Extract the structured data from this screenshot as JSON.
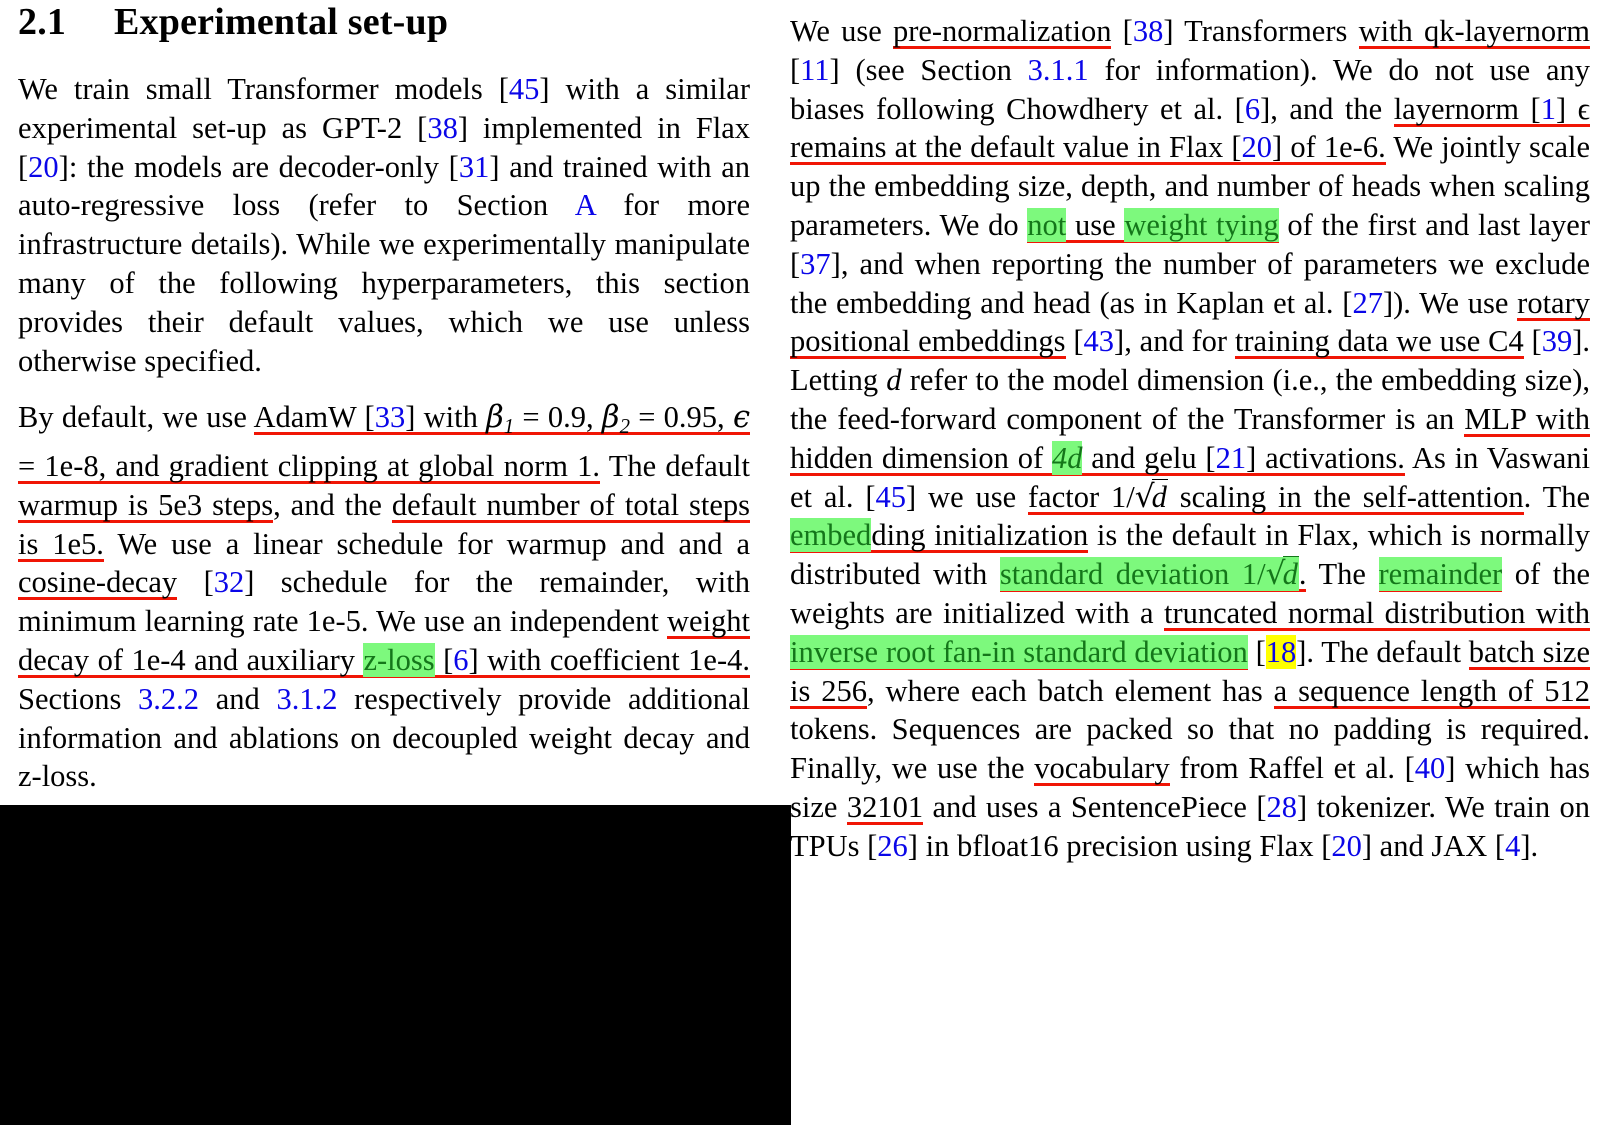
{
  "document": {
    "type": "academic-paper-excerpt",
    "heading": {
      "number": "2.1",
      "title": "Experimental set-up"
    },
    "colors": {
      "citation_blue": "#0a06e8",
      "annotation_underline_red": "#f01505",
      "highlight_green": "#7df97d",
      "highlight_green_text": "#14761a",
      "highlight_yellow": "#ffff00",
      "redaction_black": "#000000",
      "body_text": "#000000",
      "page_background": "#ffffff"
    }
  },
  "left_column": {
    "paragraph_1": {
      "t1": "We train small Transformer models ",
      "c45": "45",
      "t2": " with a similar experimental set-up as GPT-2 ",
      "c38": "38",
      "t3": " implemented in Flax ",
      "c20": "20",
      "t4": ": the models are decoder-only ",
      "c31": "31",
      "t5": " and trained with an auto-regressive loss (refer to Section ",
      "refA": "A",
      "t6": " for more infrastructure details). While we experimentally manipulate many of the following hyperparameters, this section provides their default values, which we use unless otherwise specified."
    },
    "paragraph_2": {
      "t1": "By default, we use ",
      "u1_a": "AdamW ",
      "c33": "33",
      "u1_b": " with ",
      "beta": "β",
      "sub1": "1",
      "eq1": " = 0.9, ",
      "sub2": "2",
      "eq2": " = 0.95, ",
      "epsilon": "ϵ",
      "eq3": " = 1e-8, and gradient clipping at global norm 1.",
      "t2": " The default ",
      "u2": "warmup is 5e3 steps",
      "t3": ", and the ",
      "u3": "default number of total steps is 1e5.",
      "t4": " We use a linear schedule for warmup and and a ",
      "u4": "cosine-decay",
      "t5": " ",
      "c32": "32",
      "t6": " schedule for the remainder, with minimum learning rate 1e-5. We use an independent ",
      "u5_a": "weight decay of 1e-4 and auxiliary ",
      "hl_zloss": "z-loss",
      "u5_b": " ",
      "c6": "6",
      "u5_c": " with coefficient 1e-4.",
      "t7": " Sections ",
      "ref322": "3.2.2",
      "t8": " and ",
      "ref312": "3.1.2",
      "t9": " respectively provide additional information and ablations on decoupled weight decay and z-loss."
    }
  },
  "right_column": {
    "paragraph_1": {
      "t1": "We use ",
      "u1": "pre-normalization",
      "t2": " ",
      "c38": "38",
      "t3": " Transformers ",
      "u2_a": "with qk-layernorm",
      "t4": " ",
      "c11": "11",
      "t5": " (see Section ",
      "ref311": "3.1.1",
      "t6": " for information). We do not use any biases following Chowdhery et al. ",
      "c6": "6",
      "t7": ", and the ",
      "u3_a": "layernorm ",
      "c1": "1",
      "u3_b": " ϵ remains at the default value in Flax ",
      "c20": "20",
      "u3_c": " of 1e-6.",
      "t8": " We jointly scale up the embedding size, depth, and number of heads when scaling parameters. We do ",
      "hl_not": "not",
      "t9": " use ",
      "hl_weight_tying": "weight tying",
      "t10": " of the first and last layer ",
      "c37": "37",
      "t11": ", and when reporting the number of parameters we exclude the embedding and head (as in Kaplan et al. ",
      "c27": "27",
      "t12": "). We use ",
      "u4": "rotary positional embeddings",
      "t13": " ",
      "c43": "43",
      "t14": ", and for ",
      "u5": "training data we use C4",
      "t15": " ",
      "c39": "39",
      "t16": ". Letting ",
      "d_italic": "d",
      "t17": " refer to the model dimension (i.e., the embedding size), the feed-forward component of the Transformer is an ",
      "u6_a": "MLP with hidden dimension of ",
      "hl_4d_num": "4",
      "hl_4d_var": "d",
      "u6_b": " and gelu ",
      "c21": "21",
      "u6_c": " activations.",
      "t18": " As in Vaswani et al. ",
      "c45": "45",
      "t19": " we use ",
      "u7_a": "factor 1/",
      "u7_d": "d",
      "u7_b": " scaling in the ",
      "u8": "self-attention",
      "t20": ". The ",
      "hl_embed": "embed",
      "u9": "ding initialization",
      "t21": " is the default in Flax, which is normally distributed with ",
      "hl_sd_a": "standard deviation 1/",
      "hl_sd_d": "d",
      "hl_sd_b": ".",
      "t22": " The ",
      "hl_remainder": "remainder",
      "t23": " of the weights are initialized with a ",
      "u10_a": "truncated normal distribution with ",
      "hl_inverse": "inverse root fan-in standard deviation",
      "t24": " ",
      "hl_18": "18",
      "t25": ". The default ",
      "u11": "batch size is 256",
      "t26": ", where each batch element has ",
      "u12": "a sequence length of 512",
      "t27": " tokens. Sequences are packed so that no padding is required. Finally, we use the ",
      "u13": "vocabulary",
      "t28": " from Raffel et al. ",
      "c40": "40",
      "t29": " which has size ",
      "u14": "32101",
      "t30": " and uses a SentencePiece ",
      "c28": "28",
      "t31": " tokenizer. We train on TPUs ",
      "c26": "26",
      "t32": " in bfloat16 precision using Flax ",
      "c20b": "20",
      "t33": " and JAX ",
      "c4": "4",
      "t34": "."
    }
  },
  "redaction_block": {
    "description": "black-rectangle-occluding-lower-left-region"
  }
}
